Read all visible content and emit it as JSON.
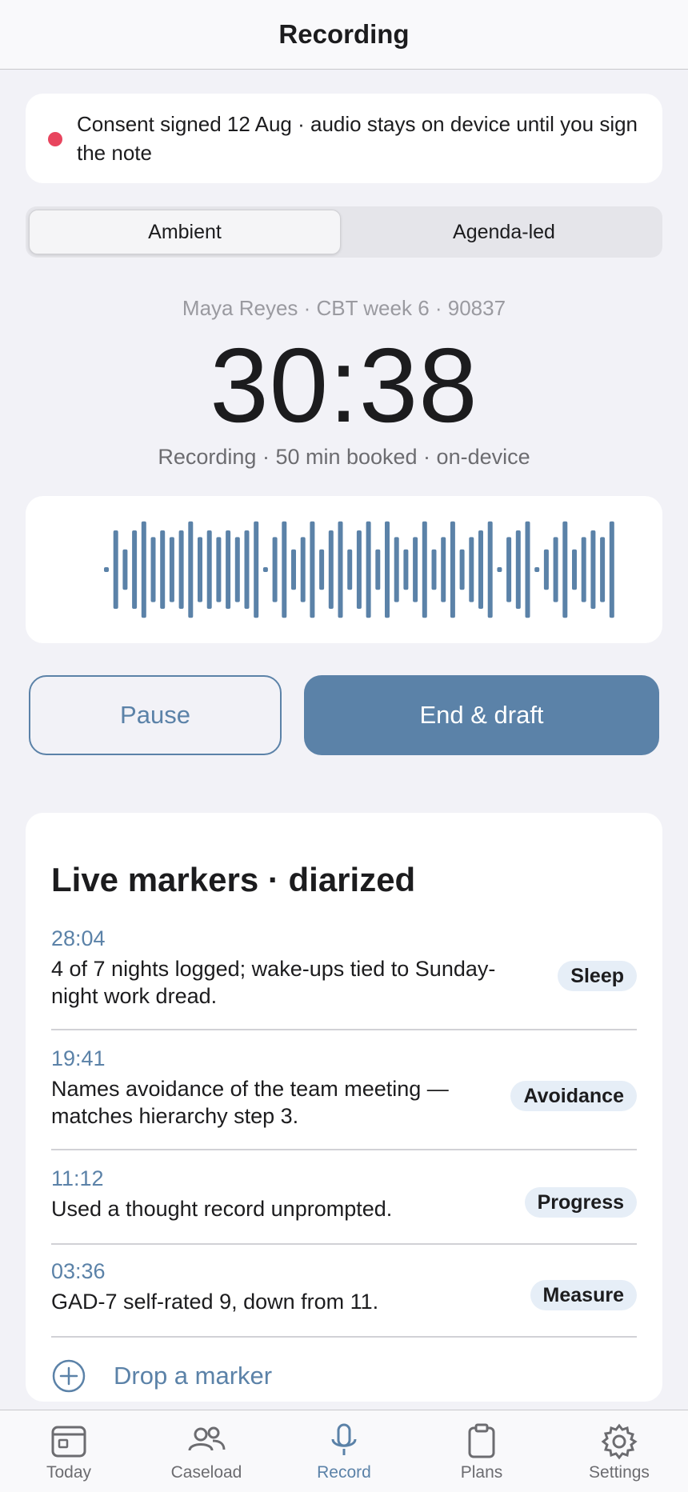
{
  "nav": {
    "title": "Recording"
  },
  "consent": {
    "text": "Consent signed 12 Aug · audio stays on device until you sign the note",
    "dot_color": "#e8455e"
  },
  "mode": {
    "options": [
      "Ambient",
      "Agenda-led"
    ],
    "selected": "Ambient"
  },
  "session": {
    "subtitle": "Maya Reyes · CBT week 6 · 90837",
    "timer": "30:38",
    "status": "Recording · 50 min booked · on-device"
  },
  "waveform": {
    "color": "#5b82a8",
    "levels": [
      0.04,
      0.7,
      0.36,
      0.7,
      0.86,
      0.58,
      0.7,
      0.58,
      0.7,
      0.86,
      0.58,
      0.7,
      0.58,
      0.7,
      0.58,
      0.7,
      0.86,
      0.04,
      0.58,
      0.86,
      0.36,
      0.58,
      0.86,
      0.36,
      0.7,
      0.86,
      0.36,
      0.7,
      0.86,
      0.36,
      0.86,
      0.58,
      0.36,
      0.58,
      0.86,
      0.36,
      0.58,
      0.86,
      0.36,
      0.58,
      0.7,
      0.86,
      0.04,
      0.58,
      0.7,
      0.86,
      0.04,
      0.36,
      0.58,
      0.86,
      0.36,
      0.58,
      0.7,
      0.58,
      0.86
    ]
  },
  "actions": {
    "pause": "Pause",
    "end": "End & draft",
    "accent": "#5b82a8"
  },
  "markers": {
    "title": "Live markers · diarized",
    "items": [
      {
        "time": "28:04",
        "lines": [
          "4 of 7 nights logged; wake-ups tied to Sunday-",
          "night work dread."
        ],
        "tag": "Sleep"
      },
      {
        "time": "19:41",
        "lines": [
          "Names avoidance of the team meeting —",
          "matches hierarchy step 3."
        ],
        "tag": "Avoidance"
      },
      {
        "time": "11:12",
        "lines": [
          "Used a thought record unprompted."
        ],
        "tag": "Progress"
      },
      {
        "time": "03:36",
        "lines": [
          "GAD-7 self-rated 9, down from 11."
        ],
        "tag": "Measure"
      }
    ],
    "add_label": "Drop a marker",
    "add_icon": "plus-circle-icon"
  },
  "tabbar": {
    "items": [
      {
        "label": "Today",
        "icon": "calendar-icon"
      },
      {
        "label": "Caseload",
        "icon": "people-icon"
      },
      {
        "label": "Record",
        "icon": "microphone-icon"
      },
      {
        "label": "Plans",
        "icon": "clipboard-icon"
      },
      {
        "label": "Settings",
        "icon": "gear-icon"
      }
    ],
    "active": "Record"
  }
}
